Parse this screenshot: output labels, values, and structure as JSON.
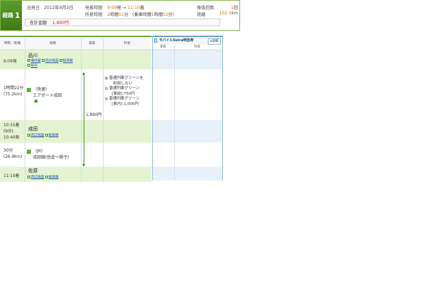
{
  "summary": {
    "route_label": "経路",
    "route_number": "1",
    "departure_date_label": "出発日",
    "departure_date": "2012年9月2日",
    "times_label": "発着時間",
    "depart_time": "9:09",
    "depart_suffix": "発",
    "arrow": "→",
    "arrive_time": "11:10",
    "arrive_suffix": "着",
    "duration_label": "所要時間",
    "duration_hours": "2",
    "duration_h_unit": "時間",
    "duration_minutes": "01",
    "duration_m_unit": "分",
    "onboard_open": "（乗車時間",
    "onboard_hours": "1",
    "onboard_h_unit": "時間",
    "onboard_minutes": "52",
    "onboard_m_unit": "分）",
    "transfers_label": "乗換回数",
    "transfers_value": "1",
    "transfers_unit": "回",
    "distance_label": "距離",
    "distance_value": "102.1",
    "distance_unit": "km",
    "total_label": "合計金額",
    "total_value": "1,890円"
  },
  "table": {
    "headers": [
      "時間／距離",
      "経路",
      "運賃",
      "料金"
    ],
    "stations": [
      {
        "time": "9:09発",
        "name": "品川",
        "links": [
          "構内図",
          "周辺地図",
          "駅情報",
          "駅弁"
        ]
      },
      {
        "time_arr": "10:31着",
        "wait": "(9分)",
        "time_dep": "10:40発",
        "name": "成田",
        "links": [
          "周辺地図",
          "駅情報"
        ]
      },
      {
        "time": "11:10着",
        "name": "佐原",
        "links": [
          "周辺地図",
          "駅情報"
        ]
      }
    ],
    "segments": [
      {
        "duration": "1時間22分",
        "distance": "(75.2km)",
        "train_type": "（快速）",
        "train_name": "エアポート成田"
      },
      {
        "duration": "30分",
        "distance": "(26.9km)",
        "train_type": "（JR）",
        "train_name": "成田線(佐倉～銚子)"
      }
    ],
    "fare": "1,890円",
    "surcharge_options": [
      {
        "line1": "普通列車グリーンを",
        "line2": "利用しない",
        "selected": true
      },
      {
        "line1": "普通列車グリーン",
        "line2": "[事前]:750円",
        "selected": false
      },
      {
        "line1": "普通列車グリーン",
        "line2": "[車内]:1,000円",
        "selected": false
      }
    ]
  },
  "suica": {
    "title": "モバイルSuica特急券",
    "detail_button": "詳細",
    "subheaders": [
      "運賃",
      "料金"
    ]
  },
  "colors": {
    "accent_green": "#3f7d15",
    "station_band": "#e4f4d2",
    "suica_band": "#e6f1fa",
    "price_red": "#d2282e"
  }
}
